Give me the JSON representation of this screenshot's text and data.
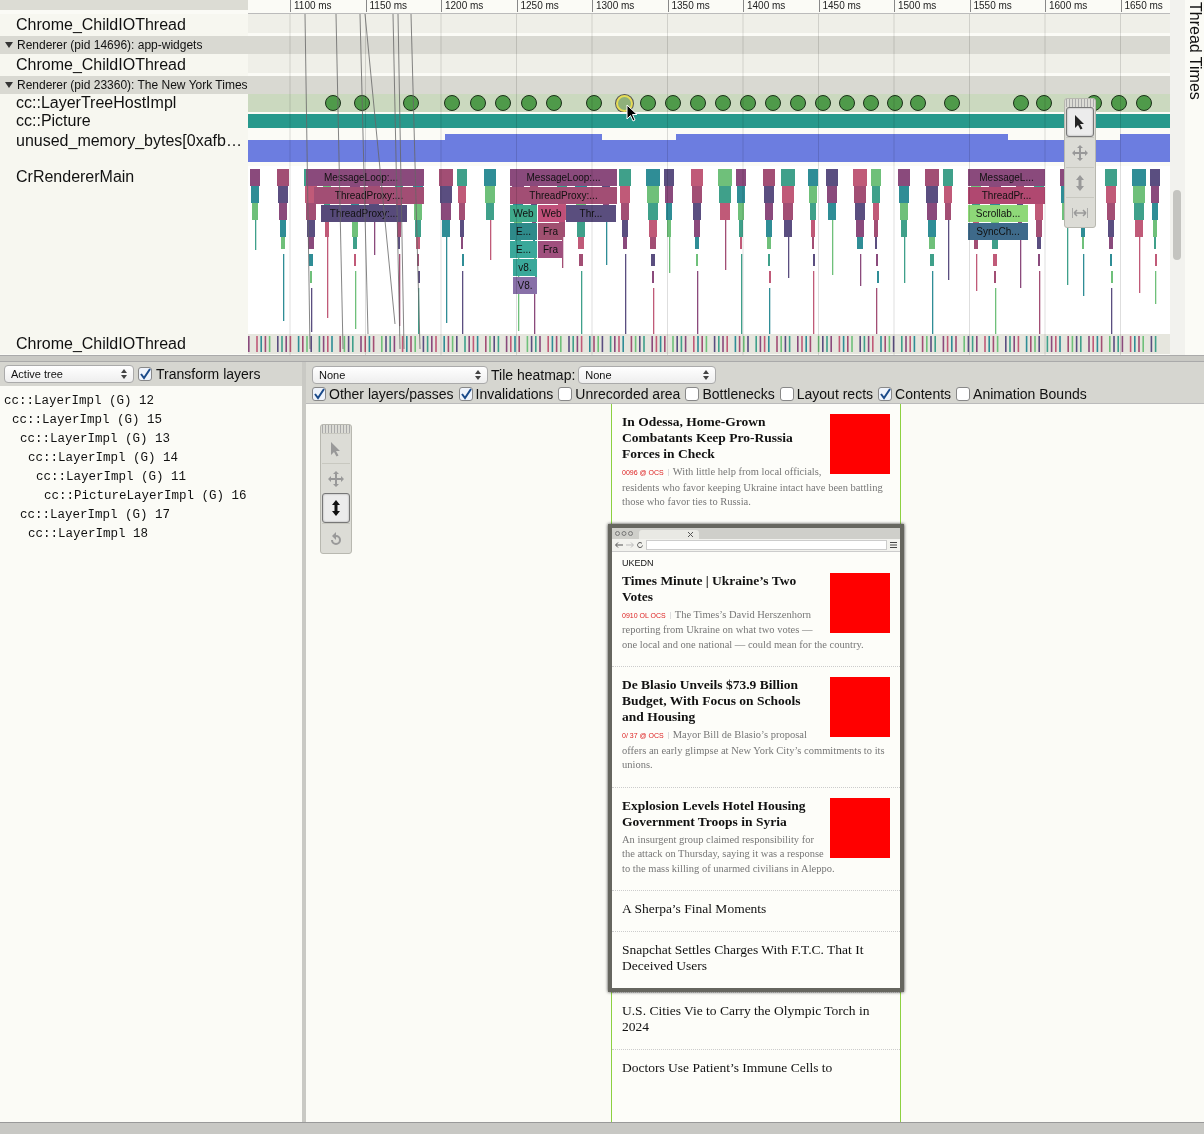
{
  "timeline": {
    "ruler_ticks": [
      "1100 ms",
      "1150 ms",
      "1200 ms",
      "1250 ms",
      "1300 ms",
      "1350 ms",
      "1400 ms",
      "1450 ms",
      "1500 ms",
      "1550 ms",
      "1600 ms",
      "1650 ms"
    ],
    "side_label": "Thread Times",
    "rows": [
      {
        "kind": "thread",
        "label": "Chrome_ChildIOThread"
      },
      {
        "kind": "process",
        "label": "Renderer (pid 14696): app-widgets",
        "expanded": true
      },
      {
        "kind": "thread",
        "label": "Chrome_ChildIOThread"
      },
      {
        "kind": "process",
        "label": "Renderer (pid 23360): The New York Times",
        "expanded": true
      },
      {
        "kind": "markers",
        "label": "cc::LayerTreeHostImpl",
        "markers": [
          {
            "selected": false
          },
          {
            "selected": false
          },
          {
            "selected": false
          },
          {
            "selected": false
          },
          {
            "selected": false
          },
          {
            "selected": false
          },
          {
            "selected": false
          },
          {
            "selected": false
          },
          {
            "selected": false
          },
          {
            "selected": true
          },
          {
            "selected": false
          },
          {
            "selected": false
          },
          {
            "selected": false
          },
          {
            "selected": false
          },
          {
            "selected": false
          },
          {
            "selected": false
          },
          {
            "selected": false
          },
          {
            "selected": false
          },
          {
            "selected": false
          },
          {
            "selected": false
          },
          {
            "selected": false
          },
          {
            "selected": false
          },
          {
            "selected": false
          },
          {
            "selected": false
          },
          {
            "selected": false
          },
          {
            "selected": false
          },
          {
            "selected": false
          },
          {
            "selected": false
          }
        ]
      },
      {
        "kind": "bar",
        "label": "cc::Picture"
      },
      {
        "kind": "counter",
        "label": "unused_memory_bytes[0xafb…"
      },
      {
        "kind": "slices",
        "label": "CrRendererMain",
        "slices": [
          {
            "label": "MessageLoop:...",
            "color": "#8a4a7c"
          },
          {
            "label": "ThreadProxy:...",
            "color": "#a24e74"
          },
          {
            "label": "ThreadProxy:...",
            "color": "#574a7a"
          },
          {
            "label": "MessageLoop:...",
            "color": "#8a4a7c"
          },
          {
            "label": "ThreadProxy:...",
            "color": "#a24e74"
          },
          {
            "label": "Web",
            "color": "#3fa88a"
          },
          {
            "label": "Web",
            "color": "#c0507a"
          },
          {
            "label": "Thr...",
            "color": "#5a4e7e"
          },
          {
            "label": "E...",
            "color": "#2e8a8a"
          },
          {
            "label": "Fra",
            "color": "#a05070"
          },
          {
            "label": "E...",
            "color": "#3aa89a"
          },
          {
            "label": "Fra",
            "color": "#a0507e"
          },
          {
            "label": "v8.",
            "color": "#3aa89a"
          },
          {
            "label": "V8.",
            "color": "#8870a8"
          },
          {
            "label": "MessageL...",
            "color": "#8a4a7c"
          },
          {
            "label": "ThreadPr...",
            "color": "#b04870"
          },
          {
            "label": "Scrollab...",
            "color": "#8ed878"
          },
          {
            "label": "SyncCh...",
            "color": "#3e6a8a"
          }
        ]
      },
      {
        "kind": "io",
        "label": "Chrome_ChildIOThread"
      }
    ],
    "tools": [
      {
        "kind": "select",
        "selected": true
      },
      {
        "kind": "pan",
        "selected": false
      },
      {
        "kind": "zoom",
        "selected": false
      },
      {
        "kind": "timing",
        "selected": false
      }
    ]
  },
  "layer_panel": {
    "tree_select": "Active tree",
    "transform_layers": {
      "label": "Transform layers",
      "checked": true
    },
    "layers": [
      {
        "label": "cc::LayerImpl (G) 12",
        "children": [
          {
            "label": "cc::LayerImpl (G) 15",
            "children": [
              {
                "label": "cc::LayerImpl (G) 13",
                "children": [
                  {
                    "label": "cc::LayerImpl (G) 14",
                    "children": [
                      {
                        "label": "cc::LayerImpl (G) 11",
                        "children": [
                          {
                            "label": "cc::PictureLayerImpl (G) 16"
                          }
                        ]
                      }
                    ]
                  }
                ]
              },
              {
                "label": "cc::LayerImpl (G) 17",
                "children": [
                  {
                    "label": "cc::LayerImpl 18"
                  }
                ]
              }
            ]
          }
        ]
      }
    ]
  },
  "viewer": {
    "overlay_select": "None",
    "heatmap_label": "Tile heatmap:",
    "heatmap_select": "None",
    "options": [
      {
        "label": "Other layers/passes",
        "checked": true
      },
      {
        "label": "Invalidations",
        "checked": true
      },
      {
        "label": "Unrecorded area",
        "checked": false
      },
      {
        "label": "Bottlenecks",
        "checked": false
      },
      {
        "label": "Layout rects",
        "checked": false
      },
      {
        "label": "Contents",
        "checked": true
      },
      {
        "label": "Animation Bounds",
        "checked": false
      }
    ],
    "tools": [
      {
        "kind": "select",
        "selected": false
      },
      {
        "kind": "pan",
        "selected": false
      },
      {
        "kind": "zoom",
        "selected": true
      },
      {
        "kind": "rotate",
        "selected": false
      }
    ],
    "page": {
      "articles_before": [
        {
          "kind": "story",
          "headline": "In Odessa, Home-Grown Combatants Keep Pro-Russia Forces in Check",
          "meta": "0096 @ OCS",
          "summary": "With little help from local officials, residents who favor keeping Ukraine intact have been battling those who favor ties to Russia.",
          "thumbnail": true
        }
      ],
      "window": {
        "section_label": "UKEDN",
        "articles": [
          {
            "kind": "story",
            "headline": "Times Minute |  Ukraine’s Two Votes",
            "meta": "0910 OL OCS",
            "summary": "The Times’s David Herszenhorn reporting from Ukraine on what two votes — one local and one national — could mean for the country.",
            "thumbnail": true
          },
          {
            "kind": "story",
            "headline": "De Blasio Unveils $73.9 Billion Budget, With Focus on Schools and Housing",
            "meta": "0/ 37 @ OCS",
            "summary": "Mayor Bill de Blasio’s proposal offers an early glimpse at New York City’s commitments to its unions.",
            "thumbnail": true
          },
          {
            "kind": "story",
            "headline": "Explosion Levels Hotel Housing Government Troops in Syria",
            "summary": "An insurgent group claimed responsibility for the attack on Thursday, saying it was a response to the mass killing of unarmed civilians in Aleppo.",
            "thumbnail": true
          },
          {
            "kind": "headline",
            "headline": "A Sherpa’s Final Moments"
          },
          {
            "kind": "headline",
            "headline": "Snapchat Settles Charges With F.T.C. That It Deceived Users"
          }
        ]
      },
      "articles_after": [
        {
          "kind": "headline",
          "headline": "U.S. Cities Vie to Carry the Olympic Torch in 2024"
        },
        {
          "kind": "headline",
          "headline": "Doctors Use Patient’s Immune Cells to"
        }
      ]
    }
  }
}
